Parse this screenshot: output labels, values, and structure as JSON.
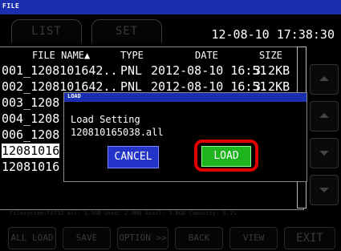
{
  "window": {
    "title": "FILE"
  },
  "tabs": [
    {
      "label": "LIST"
    },
    {
      "label": "SET"
    }
  ],
  "datetime": "12-08-10 17:38:30",
  "table": {
    "headers": {
      "name": "FILE NAME▲",
      "type": "TYPE",
      "date": "DATE",
      "size": "SIZE"
    },
    "rows": [
      {
        "name": "001_1208101642..",
        "type": "PNL",
        "date": "2012-08-10 16:51",
        "size": "3.2KB"
      },
      {
        "name": "002_1208101642..",
        "type": "PNL",
        "date": "2012-08-10 16:51",
        "size": "3.2KB"
      },
      {
        "name": "003_1208",
        "type": "",
        "date": "",
        "size": ""
      },
      {
        "name": "004_1208",
        "type": "",
        "date": "",
        "size": ""
      },
      {
        "name": "006_1208",
        "type": "",
        "date": "",
        "size": ""
      },
      {
        "name": "12081016",
        "type": "",
        "date": "",
        "size": "",
        "selected": true
      },
      {
        "name": "12081016",
        "type": "",
        "date": "",
        "size": ""
      }
    ]
  },
  "status_line": "Filesystem:FAT32 All: 3.9GB Used: 2.9MB Avail: 3.8GB Capacity: 0.1%",
  "bottom_buttons": [
    {
      "label": "ALL LOAD"
    },
    {
      "label": "SAVE"
    },
    {
      "label": "OPTION >>"
    },
    {
      "label": "BACK"
    },
    {
      "label": "VIEW"
    },
    {
      "label": "EXIT"
    }
  ],
  "dialog": {
    "title": "LOAD",
    "message": "Load Setting",
    "filename": "120810165038.all",
    "cancel_label": "CANCEL",
    "load_label": "LOAD"
  },
  "colors": {
    "titlebar": "#1a2fb0",
    "cancel_button": "#2335c8",
    "load_button": "#1eb41e",
    "highlight": "#e00000"
  },
  "icons": {
    "nav_up": "triangle-up-icon",
    "nav_down": "triangle-down-icon"
  }
}
